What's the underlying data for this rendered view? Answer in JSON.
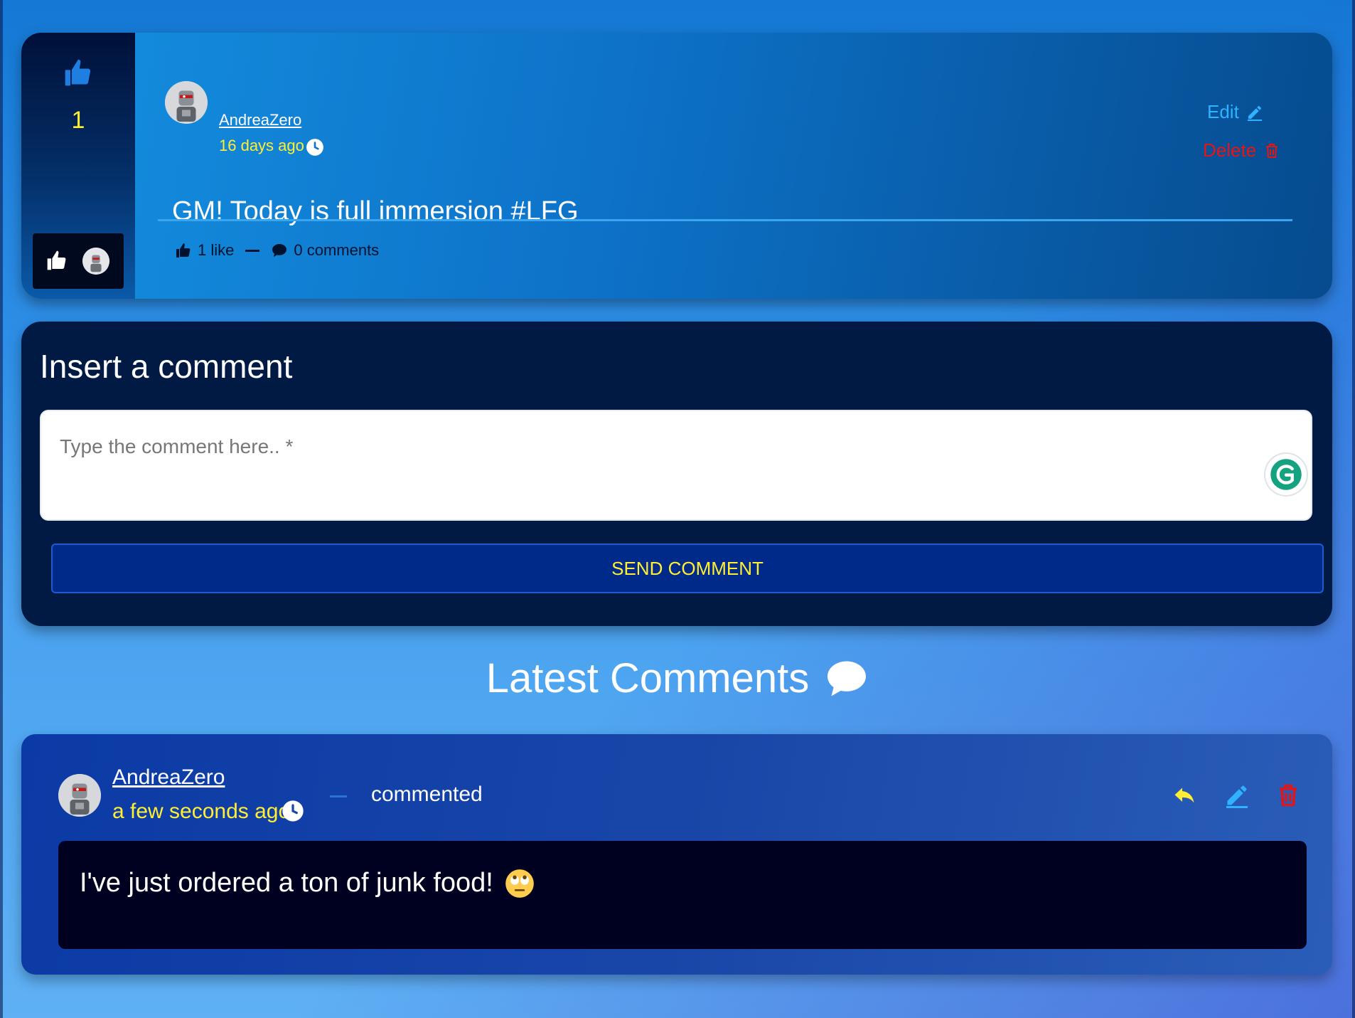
{
  "colors": {
    "accent_yellow": "#ffee33",
    "edit_blue": "#2fb2ff",
    "delete_red": "#e81414",
    "form_bg": "#001a44",
    "comment_body_bg": "#000020"
  },
  "post": {
    "vote_count": "1",
    "author": "AndreaZero",
    "time": "16 days ago",
    "text": "GM! Today is full immersion #LFG",
    "likes_label": "1 like",
    "comments_label": "0 comments",
    "edit_label": "Edit",
    "delete_label": "Delete",
    "icons": [
      "thumbs-up-icon",
      "clock-icon",
      "pencil-icon",
      "trash-icon",
      "comment-icon"
    ]
  },
  "comment_form": {
    "title": "Insert a comment",
    "placeholder": "Type the comment here.. *",
    "send_label": "SEND COMMENT"
  },
  "latest": {
    "title": "Latest Comments",
    "comments": [
      {
        "author": "AndreaZero",
        "time": "a few seconds ago",
        "action_text": "commented",
        "text": "I've just ordered a ton of junk food!",
        "emoji": "face-with-rolling-eyes"
      }
    ]
  }
}
